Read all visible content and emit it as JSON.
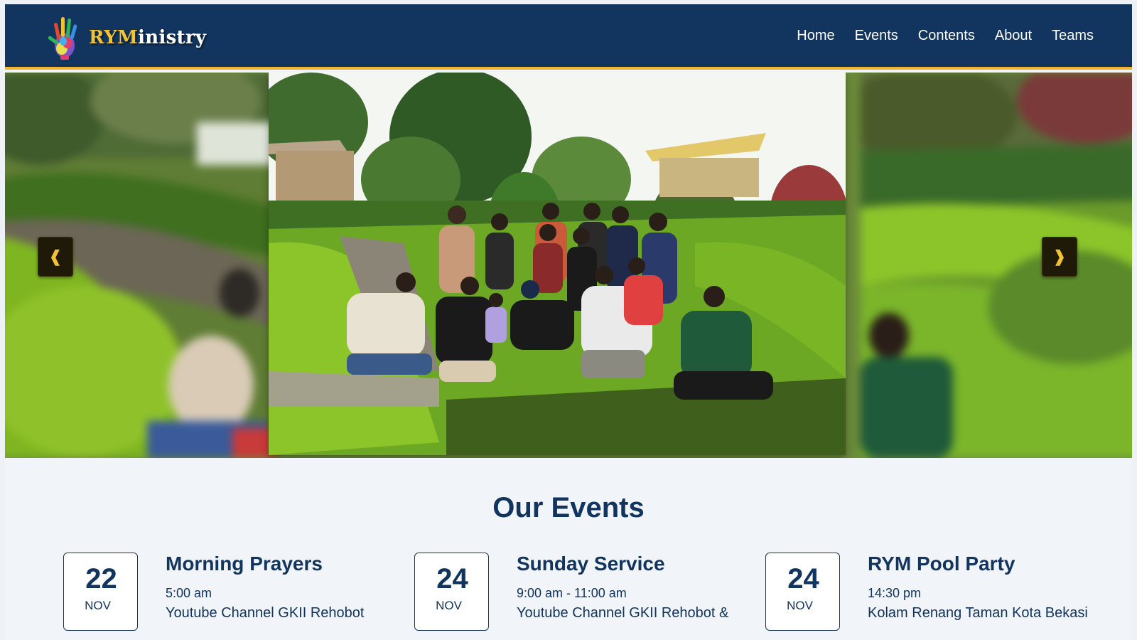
{
  "header": {
    "brand_accent": "RYM",
    "brand_rest": "inistry",
    "nav": [
      "Home",
      "Events",
      "Contents",
      "About",
      "Teams"
    ]
  },
  "carousel": {
    "prev_label": "❰",
    "next_label": "❱"
  },
  "events": {
    "heading": "Our Events",
    "items": [
      {
        "day": "22",
        "month": "NOV",
        "title": "Morning Prayers",
        "time": "5:00 am",
        "location": "Youtube Channel GKII Rehobot"
      },
      {
        "day": "24",
        "month": "NOV",
        "title": "Sunday Service",
        "time": "9:00 am - 11:00 am",
        "location": "Youtube Channel GKII Rehobot &"
      },
      {
        "day": "24",
        "month": "NOV",
        "title": "RYM Pool Party",
        "time": "14:30 pm",
        "location": "Kolam Renang Taman Kota Bekasi"
      }
    ]
  },
  "colors": {
    "navy": "#123560",
    "gold": "#f2b530",
    "background": "#f1f4f9"
  },
  "icons": {
    "logo": "colorful-hand-icon",
    "prev": "chevron-left-icon",
    "next": "chevron-right-icon"
  }
}
